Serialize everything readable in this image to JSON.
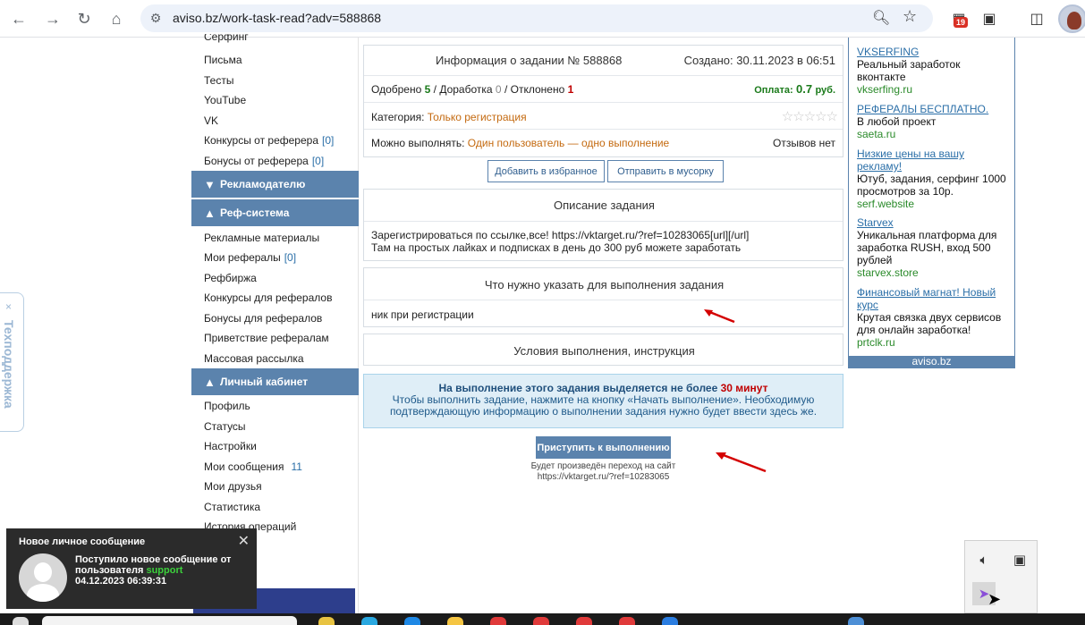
{
  "browser": {
    "url": "aviso.bz/work-task-read?adv=588868",
    "extension_badge": "19"
  },
  "sidebar": {
    "items_top": [
      {
        "label": "Серфинг",
        "count": ""
      },
      {
        "label": "Письма",
        "count": ""
      },
      {
        "label": "Тесты",
        "count": ""
      },
      {
        "label": "YouTube",
        "count": ""
      },
      {
        "label": "VK",
        "count": ""
      },
      {
        "label": "Конкурсы от реферера",
        "count": "[0]"
      },
      {
        "label": "Бонусы от реферера",
        "count": "[0]"
      }
    ],
    "head_advertiser": "Рекламодателю",
    "head_ref": "Реф-система",
    "items_ref": [
      {
        "label": "Рекламные материалы",
        "count": ""
      },
      {
        "label": "Мои рефералы",
        "count": "[0]"
      },
      {
        "label": "Рефбиржа",
        "count": ""
      },
      {
        "label": "Конкурсы для рефералов",
        "count": ""
      },
      {
        "label": "Бонусы для рефералов",
        "count": ""
      },
      {
        "label": "Приветствие рефералам",
        "count": ""
      },
      {
        "label": "Массовая рассылка",
        "count": ""
      }
    ],
    "head_cabinet": "Личный кабинет",
    "items_cabinet": [
      {
        "label": "Профиль",
        "count": ""
      },
      {
        "label": "Статусы",
        "count": ""
      },
      {
        "label": "Настройки",
        "count": ""
      },
      {
        "label": "Мои сообщения",
        "count": "11"
      },
      {
        "label": "Мои друзья",
        "count": ""
      },
      {
        "label": "Статистика",
        "count": ""
      },
      {
        "label": "История операций",
        "count": ""
      }
    ]
  },
  "techsupport": {
    "label": "Техподдержка",
    "close": "×"
  },
  "task": {
    "title": "Информация о задании № 588868",
    "created": "Создано: 30.11.2023 в 06:51",
    "approved_label": "Одобрено",
    "approved": "5",
    "revision_label": "/ Доработка",
    "revision": "0",
    "rejected_label": "/ Отклонено",
    "rejected": "1",
    "pay_label": "Оплата:",
    "pay_value": "0.7",
    "pay_unit": "руб.",
    "category_label": "Категория:",
    "category": "Только регистрация",
    "rating_stars": "☆☆☆☆☆",
    "can_do_label": "Можно выполнять:",
    "can_do": "Один пользователь — одно выполнение",
    "reviews": "Отзывов нет",
    "btn_favorite": "Добавить в избранное",
    "btn_trash": "Отправить в мусорку",
    "desc_header": "Описание задания",
    "desc_line1": "Зарегистрироваться по ссылке,все! https://vktarget.ru/?ref=10283065[url][/url]",
    "desc_line2": "Там на простых лайках и подписках в день до 300 руб можете заработать",
    "need_header": "Что нужно указать для выполнения задания",
    "need_text": "ник при регистрации",
    "cond_header": "Условия выполнения, инструкция",
    "notice_bold": "На выполнение этого задания выделяется не более",
    "notice_time": "30 минут",
    "notice_line2": "Чтобы выполнить задание, нажмите на кнопку «Начать выполнение». Необходимую",
    "notice_line3": "подтверждающую информацию о выполнении задания нужно будет ввести здесь же.",
    "start_btn": "Приступить к выполнению",
    "redirect_line1": "Будет произведён переход на сайт",
    "redirect_line2": "https://vktarget.ru/?ref=10283065"
  },
  "ads": [
    {
      "title": "VKSERFING",
      "desc": "Реальный заработок вконтакте",
      "url": "vkserfing.ru"
    },
    {
      "title": "РЕФЕРАЛЫ БЕСПЛАТНО.",
      "desc": "В любой проект",
      "url": "saeta.ru"
    },
    {
      "title": "Низкие цены на вашу рекламу!",
      "desc": "Ютуб, задания, серфинг 1000 просмотров за 10р.",
      "url": "serf.website"
    },
    {
      "title": "Starvex",
      "desc": "Уникальная платформа для заработка RUSH, вход 500 рублей",
      "url": "starvex.store"
    },
    {
      "title": "Финансовый магнат! Новый курс",
      "desc": "Крутая связка двух сервисов для онлайн заработка!",
      "url": "prtclk.ru"
    }
  ],
  "ads_footer": "aviso.bz",
  "toast": {
    "title": "Новое личное сообщение",
    "line1": "Поступило новое сообщение от",
    "line2_prefix": "пользователя",
    "user": "support",
    "time": "04.12.2023 06:39:31"
  },
  "colors": {
    "accent": "#5b83ad",
    "link": "#2b6fa8",
    "green": "#1a7a1a",
    "red": "#c00000",
    "orange": "#c46a10"
  }
}
